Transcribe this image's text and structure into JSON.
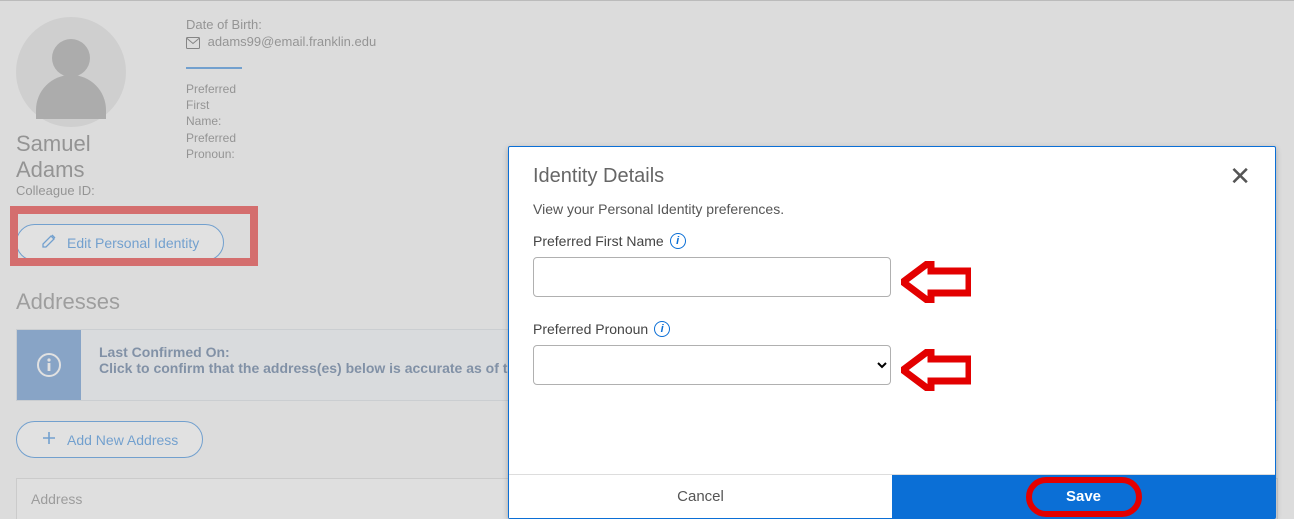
{
  "profile": {
    "name": "Samuel Adams",
    "colleague_id_label": "Colleague ID:",
    "dob_label": "Date of Birth:",
    "email": "adams99@email.franklin.edu",
    "pref_first_name_label": "Preferred First Name:",
    "pref_pronoun_label": "Preferred Pronoun:"
  },
  "buttons": {
    "edit_identity": "Edit Personal Identity",
    "add_new_address": "Add New Address"
  },
  "sections": {
    "addresses_title": "Addresses"
  },
  "notice": {
    "line1": "Last Confirmed On:",
    "line2_partial": "Click to confirm that the address(es) below is accurate as of to"
  },
  "table": {
    "col_address": "Address"
  },
  "modal": {
    "title": "Identity Details",
    "subtext": "View your Personal Identity preferences.",
    "field1_label": "Preferred First Name",
    "field1_value": "",
    "field2_label": "Preferred Pronoun",
    "field2_value": "",
    "cancel": "Cancel",
    "save": "Save"
  }
}
